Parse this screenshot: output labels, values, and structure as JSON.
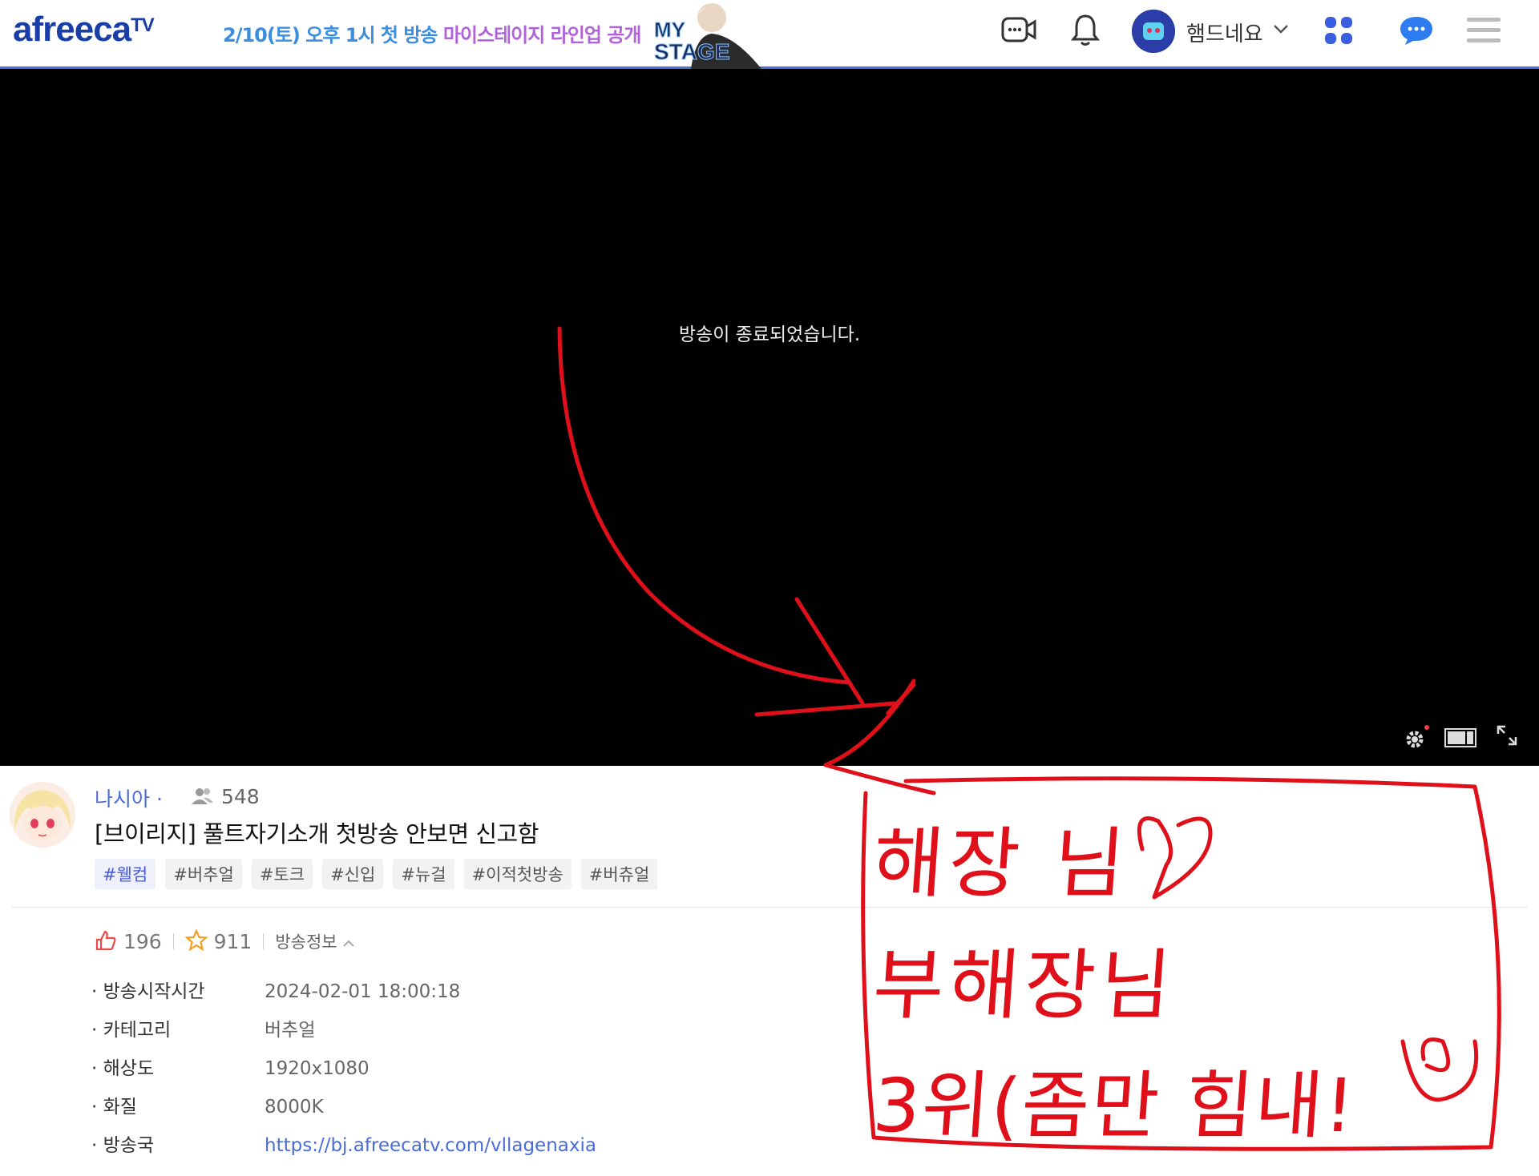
{
  "header": {
    "logo": "afreeca",
    "logo_suffix": "TV",
    "promo_part1": "2/10(토) 오후 1시 첫 방송",
    "promo_part2": "마이스테이지 라인업 공개",
    "banner_text_1": "MY",
    "banner_text_2": "STAGE",
    "profile_name": "햄드네요",
    "icons": [
      "video-chat-icon",
      "bell-icon",
      "profile-avatar",
      "chevron-down-icon",
      "apps-grid-icon",
      "chat-icon",
      "menu-icon"
    ],
    "accent": "#4a6bd8"
  },
  "player": {
    "message": "방송이 종료되었습니다.",
    "controls": [
      "settings-icon",
      "theater-mode-icon",
      "fullscreen-icon"
    ]
  },
  "broadcast": {
    "bj_name": "나시아",
    "viewers": "548",
    "title": "[브이리지] 풀트자기소개 첫방송 안보면 신고함",
    "tags": [
      "#웰컴",
      "#버추얼",
      "#토크",
      "#신입",
      "#뉴걸",
      "#이적첫방송",
      "#버츄얼"
    ],
    "likes": "196",
    "favorites": "911",
    "info_toggle": "방송정보",
    "info": [
      {
        "key": "방송시작시간",
        "value": "2024-02-01 18:00:18"
      },
      {
        "key": "카테고리",
        "value": "버추얼"
      },
      {
        "key": "해상도",
        "value": "1920x1080"
      },
      {
        "key": "화질",
        "value": "8000K"
      },
      {
        "key": "방송국",
        "value": "https://bj.afreecatv.com/vllagenaxia"
      }
    ]
  },
  "annotation": {
    "line1": "해장 님",
    "line2": "부해장님",
    "line3": "3위(좀만 힘내!",
    "color": "#e0101a"
  }
}
